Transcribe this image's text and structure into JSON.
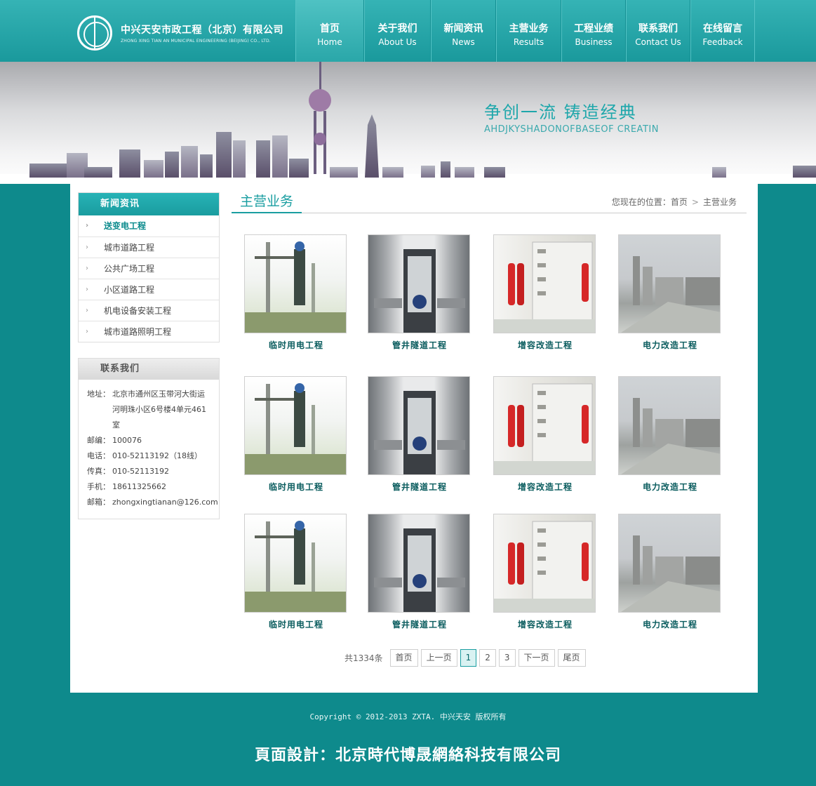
{
  "header": {
    "company_cn": "中兴天安市政工程（北京）有限公司",
    "company_en": "ZHONG XING TIAN AN MUNICIPAL ENGINEERING (BEIJING) CO., LTD.",
    "nav": [
      {
        "cn": "首页",
        "en": "Home"
      },
      {
        "cn": "关于我们",
        "en": "About Us"
      },
      {
        "cn": "新闻资讯",
        "en": "News"
      },
      {
        "cn": "主营业务",
        "en": "Results"
      },
      {
        "cn": "工程业绩",
        "en": "Business"
      },
      {
        "cn": "联系我们",
        "en": "Contact Us"
      },
      {
        "cn": "在线留言",
        "en": "Feedback"
      }
    ]
  },
  "banner": {
    "slogan_cn": "争创一流  铸造经典",
    "slogan_en": "AHDJKYSHADONOFBASEOF CREATIN"
  },
  "sidebar": {
    "news_title": "新闻资讯",
    "items": [
      "送变电工程",
      "城市道路工程",
      "公共广场工程",
      "小区道路工程",
      "机电设备安装工程",
      "城市道路照明工程"
    ],
    "contact_title": "联系我们",
    "contact": {
      "address_label": "地址：",
      "address": "北京市通州区玉带河大街运河明珠小区6号楼4单元461室",
      "zip_label": "邮编：",
      "zip": "100076",
      "phone_label": "电话：",
      "phone": "010-52113192（18线）",
      "fax_label": "传真：",
      "fax": "010-52113192",
      "mobile_label": "手机：",
      "mobile": "18611325662",
      "email_label": "邮箱：",
      "email": "zhongxingtianan@126.com"
    }
  },
  "main": {
    "title": "主营业务",
    "breadcrumb_prefix": "您现在的位置：",
    "breadcrumb_home": "首页",
    "breadcrumb_sep": ">",
    "breadcrumb_current": "主营业务",
    "products": [
      "临时用电工程",
      "管井隧道工程",
      "增容改造工程",
      "电力改造工程",
      "临时用电工程",
      "管井隧道工程",
      "增容改造工程",
      "电力改造工程",
      "临时用电工程",
      "管井隧道工程",
      "增容改造工程",
      "电力改造工程"
    ],
    "pager": {
      "total": "共1334条",
      "first": "首页",
      "prev": "上一页",
      "pages": [
        "1",
        "2",
        "3"
      ],
      "next": "下一页",
      "last": "尾页"
    }
  },
  "footer": {
    "copyright": "Copyright © 2012-2013 ZXTA. 中兴天安 版权所有",
    "design": "頁面設計：北京時代博晟網絡科技有限公司"
  },
  "colors": {
    "brand": "#1a9ea1",
    "background": "#0e8a8c"
  }
}
